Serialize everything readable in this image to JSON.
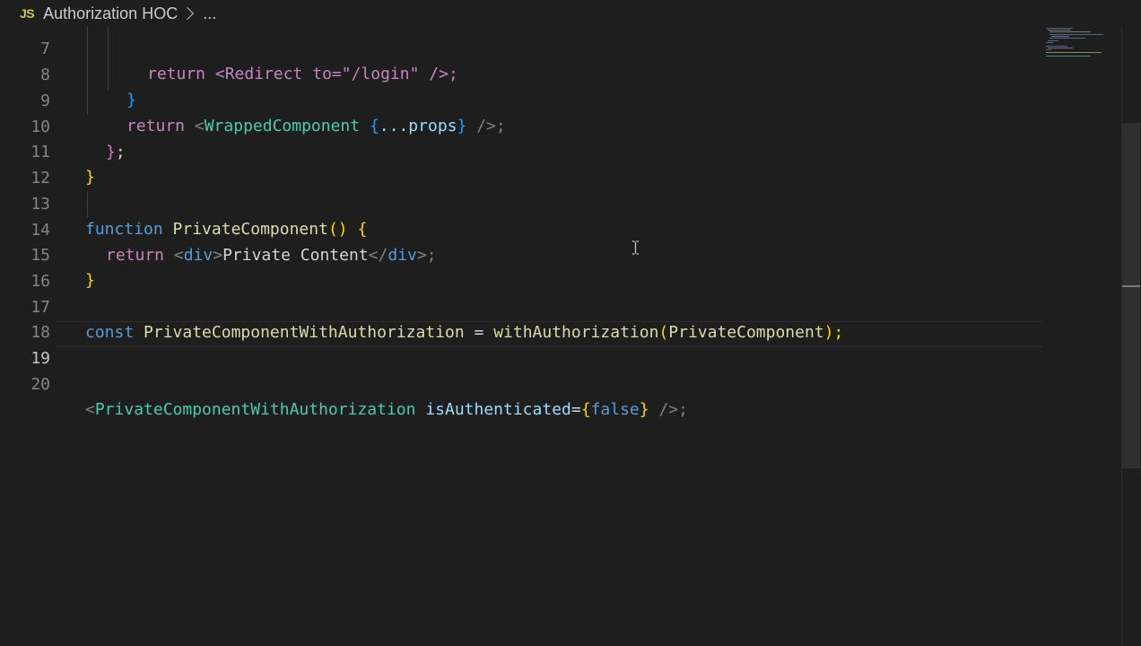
{
  "breadcrumb": {
    "file_type": "JS",
    "file_name": "Authorization HOC",
    "ellipsis": "..."
  },
  "colors": {
    "background": "#1e1e1e",
    "keyword": "#569cd6",
    "control": "#c586c0",
    "function": "#dcdcaa",
    "variable": "#9cdcfe",
    "component": "#4ec9b0",
    "bracket_gold": "#ffd700",
    "bracket_purple": "#da70d6",
    "bracket_blue": "#179fff"
  },
  "lines": [
    {
      "number": "7",
      "partial": "return <Redirect to=\"/login\" />;"
    },
    {
      "number": "8"
    },
    {
      "number": "9",
      "tokens": [
        "return",
        "<",
        "WrappedComponent",
        "{",
        "...props",
        "}",
        "/>;"
      ]
    },
    {
      "number": "10",
      "tokens": [
        "}",
        ";"
      ]
    },
    {
      "number": "11",
      "tokens": [
        "}"
      ]
    },
    {
      "number": "12"
    },
    {
      "number": "13",
      "tokens": [
        "function",
        "PrivateComponent",
        "()",
        "{"
      ]
    },
    {
      "number": "14",
      "tokens": [
        "return",
        "<",
        "div",
        ">",
        "Private Content",
        "</",
        "div",
        ">;"
      ]
    },
    {
      "number": "15",
      "tokens": [
        "}"
      ]
    },
    {
      "number": "16"
    },
    {
      "number": "17",
      "tokens": [
        "const",
        "PrivateComponentWithAuthorization",
        "=",
        "withAuthorization",
        "(",
        "PrivateComponent",
        ");"
      ]
    },
    {
      "number": "18"
    },
    {
      "number": "19"
    },
    {
      "number": "20",
      "tokens": [
        "<",
        "PrivateComponentWithAuthorization",
        "isAuthenticated",
        "=",
        "{",
        "false",
        "}",
        "/>;"
      ]
    }
  ]
}
